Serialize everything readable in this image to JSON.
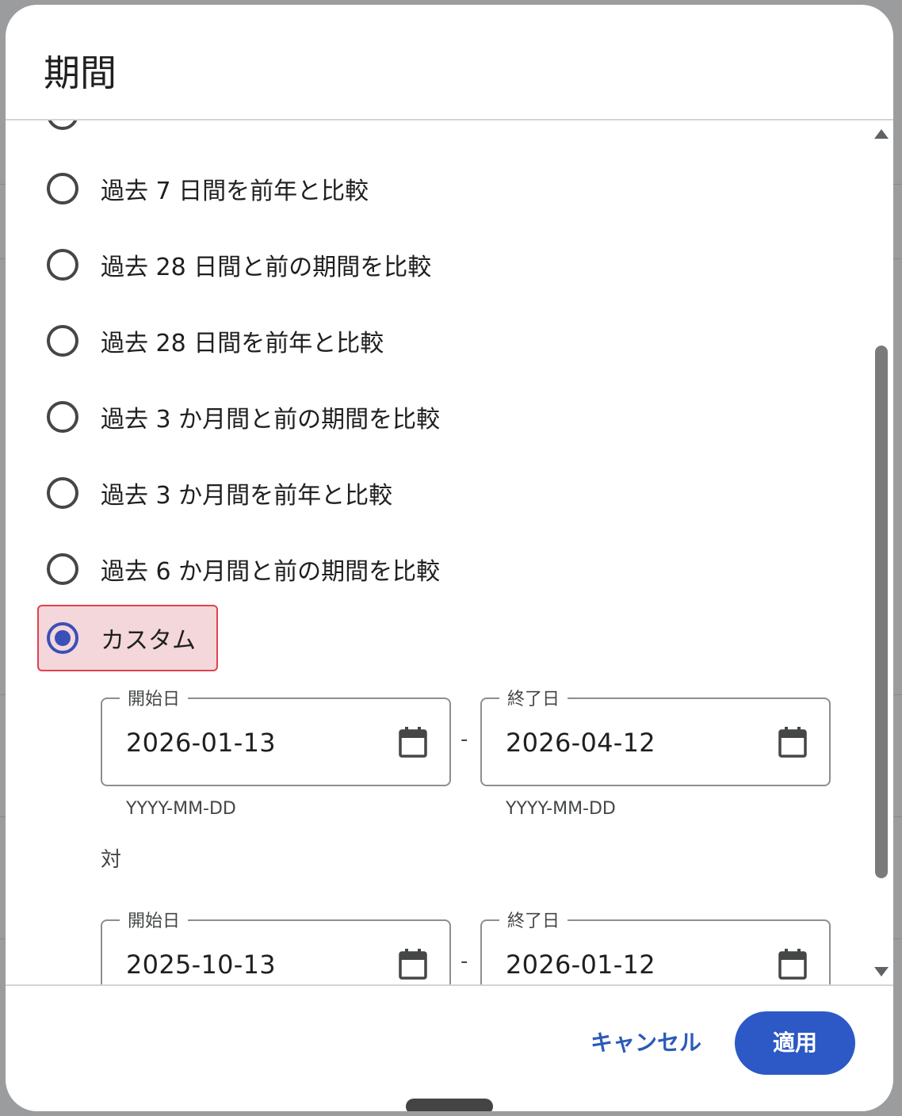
{
  "dialog": {
    "title": "期間",
    "options": [
      {
        "label": "過去 7 日間を前年と比較",
        "checked": false
      },
      {
        "label": "過去 28 日間と前の期間を比較",
        "checked": false
      },
      {
        "label": "過去 28 日間を前年と比較",
        "checked": false
      },
      {
        "label": "過去 3 か月間と前の期間を比較",
        "checked": false
      },
      {
        "label": "過去 3 か月間を前年と比較",
        "checked": false
      },
      {
        "label": "過去 6 か月間と前の期間を比較",
        "checked": false
      },
      {
        "label": "カスタム",
        "checked": true
      }
    ],
    "range1": {
      "start_label": "開始日",
      "start_value": "2026-01-13",
      "end_label": "終了日",
      "end_value": "2026-04-12",
      "start_hint": "YYYY-MM-DD",
      "end_hint": "YYYY-MM-DD",
      "separator": "-"
    },
    "vs_label": "対",
    "range2": {
      "start_label": "開始日",
      "start_value": "2025-10-13",
      "end_label": "終了日",
      "end_value": "2026-01-12",
      "separator": "-"
    },
    "cancel_label": "キャンセル",
    "apply_label": "適用"
  },
  "colors": {
    "accent": "#3b4fb8",
    "apply_button": "#2d59c6",
    "highlight_fill": "#f3d7da",
    "highlight_border": "#e0424f"
  }
}
